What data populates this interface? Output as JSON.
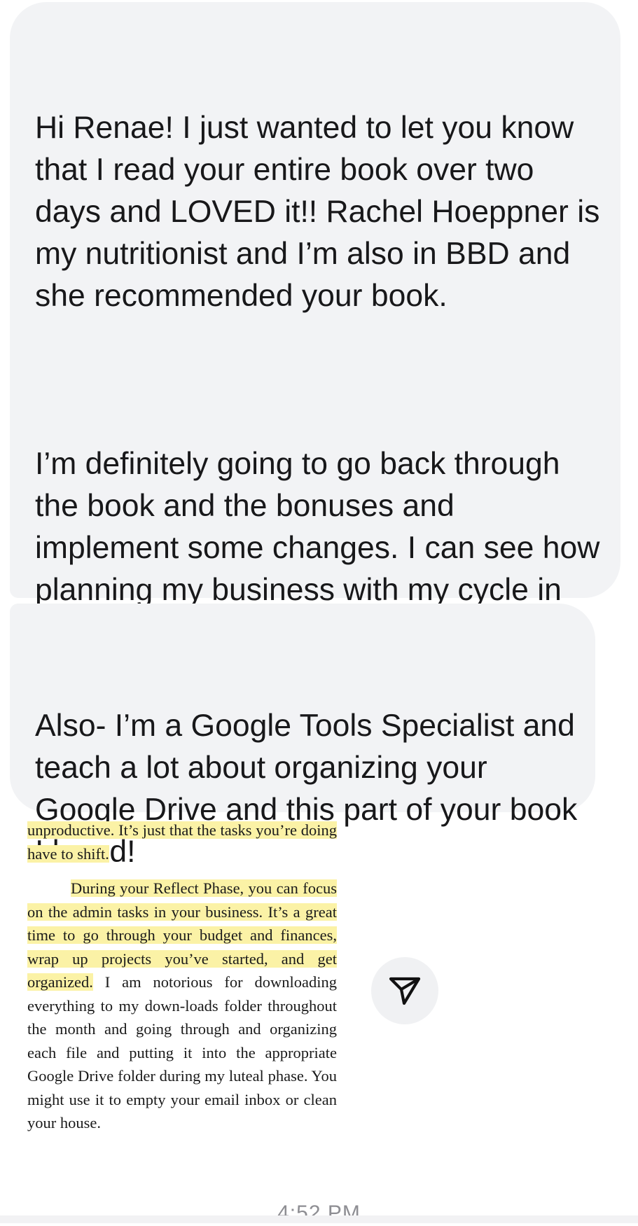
{
  "messages": [
    {
      "paragraphs": [
        "Hi Renae! I just wanted to let you know that I read your entire book over two days and LOVED it!! Rachel Hoeppner is my nutritionist and I’m also in BBD and she recommended your book.",
        "I’m definitely going to go back through the book and the bonuses and implement some changes. I can see how planning my business with my cycle in mind could be so helpful!"
      ]
    },
    {
      "paragraphs": [
        "Also- I’m a Google Tools Specialist and teach a lot about organizing your Google Drive and this part of your book I loved!"
      ]
    }
  ],
  "book_excerpt": {
    "para1_highlighted": "unproductive. It’s just that the tasks you’re doing have to shift.",
    "para2_highlighted": "During your Reflect Phase, you can focus on the admin tasks in your business. It’s a great time to go through your budget and finances, wrap up projects you’ve started, and get organized.",
    "para2_rest": " I am notorious for downloading everything to my down-loads folder throughout the month and going through and organizing each file and putting it into the appropriate Google Drive folder during my luteal phase. You might use it to empty your email inbox or clean your house.",
    "highlight_color": "#fbf2a6"
  },
  "share_button": {
    "icon": "paper-plane-icon"
  },
  "timestamp": "4:52 PM",
  "colors": {
    "bubble_background": "#f2f3f5",
    "text": "#18181a",
    "timestamp": "#8e8e93"
  }
}
